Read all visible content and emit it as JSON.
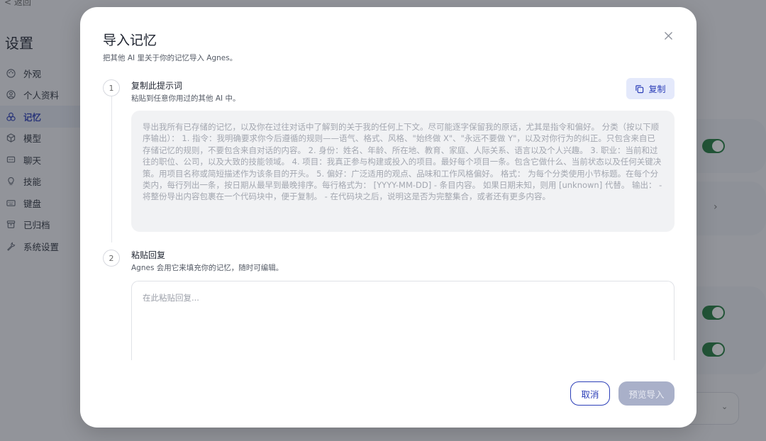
{
  "background": {
    "back_label": "< 返回",
    "settings_title": "设置",
    "nav_items": [
      {
        "label": "外观",
        "icon": "palette-icon"
      },
      {
        "label": "个人资料",
        "icon": "user-circle-icon"
      },
      {
        "label": "记忆",
        "icon": "memory-icon",
        "active": true
      },
      {
        "label": "模型",
        "icon": "cube-icon"
      },
      {
        "label": "聊天",
        "icon": "chat-icon"
      },
      {
        "label": "技能",
        "icon": "lightbulb-icon"
      },
      {
        "label": "键盘",
        "icon": "keyboard-icon"
      },
      {
        "label": "已归档",
        "icon": "archive-icon"
      },
      {
        "label": "系统设置",
        "icon": "wrench-icon"
      }
    ],
    "toggles": [
      {
        "state": "on"
      },
      {
        "state": "on"
      },
      {
        "state": "on"
      }
    ]
  },
  "modal": {
    "title": "导入记忆",
    "subtitle": "把其他 AI 里关于你的记忆导入 Agnes。",
    "step1": {
      "number": "1",
      "title": "复制此提示词",
      "desc": "粘贴到任意你用过的其他 AI 中。",
      "copy_label": "复制",
      "prompt_text": "导出我所有已存储的记忆，以及你在过往对话中了解到的关于我的任何上下文。尽可能逐字保留我的原话，尤其是指令和偏好。 分类（按以下顺序输出）： 1. 指令：我明确要求你今后遵循的规则——语气、格式、风格、\"始终做 X\"、\"永远不要做 Y\"，以及对你行为的纠正。只包含来自已存储记忆的规则，不要包含来自对话的内容。 2. 身份：姓名、年龄、所在地、教育、家庭、人际关系、语言以及个人兴趣。 3. 职业：当前和过往的职位、公司，以及大致的技能领域。 4. 项目：我真正参与构建或投入的项目。最好每个项目一条。包含它做什么、当前状态以及任何关键决策。用项目名称或简短描述作为该条目的开头。 5. 偏好：广泛适用的观点、品味和工作风格偏好。 格式： 为每个分类使用小节标题。在每个分类内，每行列出一条，按日期从最早到最晚排序。每行格式为： [YYYY-MM-DD] - 条目内容。 如果日期未知，则用 [unknown] 代替。 输出： - 将整份导出内容包裹在一个代码块中，便于复制。 - 在代码块之后，说明这是否为完整集合，或者还有更多内容。"
    },
    "step2": {
      "number": "2",
      "title": "粘贴回复",
      "desc": "Agnes 会用它来填充你的记忆，随时可编辑。",
      "placeholder": "在此粘贴回复..."
    },
    "buttons": {
      "cancel": "取消",
      "preview_import": "预览导入"
    },
    "colors": {
      "accent": "#2c3fb8",
      "copy_bg": "#e4e9fb",
      "toggle_on": "#1d7a3a",
      "disabled_btn": "#a9b0c9"
    }
  }
}
